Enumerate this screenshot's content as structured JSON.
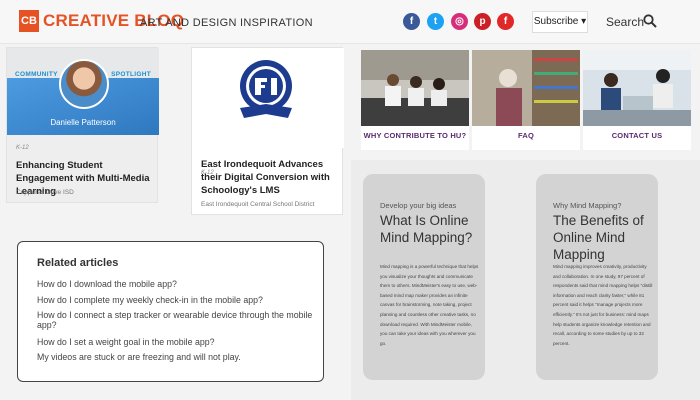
{
  "header": {
    "logo_mark": "CB",
    "logo_name": "CREATIVE BLOQ",
    "tagline": "ART AND DESIGN INSPIRATION",
    "social": [
      {
        "name": "facebook-icon",
        "glyph": "f",
        "color": "#3b5998"
      },
      {
        "name": "twitter-icon",
        "glyph": "t",
        "color": "#1da1f2"
      },
      {
        "name": "instagram-icon",
        "glyph": "◎",
        "color": "#d62e7b"
      },
      {
        "name": "pinterest-icon",
        "glyph": "p",
        "color": "#cb2027"
      },
      {
        "name": "flipboard-icon",
        "glyph": "f",
        "color": "#e12828"
      }
    ],
    "subscribe_label": "Subscribe ▾",
    "search_label": "Search"
  },
  "cards": [
    {
      "chip_left": "COMMUNITY",
      "chip_right": "SPOTLIGHT",
      "person": "Danielle Patterson",
      "tag": "K-12",
      "title": "Enhancing Student Engagement with Multi-Media Learning",
      "source": "Copperas Cove ISD"
    },
    {
      "tag": "K-12",
      "title": "East Irondequoit Advances their Digital Conversion with Schoology's LMS",
      "source": "East Irondequoit Central School District"
    }
  ],
  "tiles": [
    {
      "label": "WHY CONTRIBUTE TO HU?"
    },
    {
      "label": "FAQ"
    },
    {
      "label": "CONTACT US"
    }
  ],
  "mindmap": [
    {
      "kicker": "Develop your big ideas",
      "title": "What Is Online Mind Mapping?",
      "body": "Mind mapping is a powerful technique that helps you visualize your thoughts and communicate them to others. MindMeister's easy to use, web-based mind map maker provides an infinite canvas for brainstorming, note taking, project planning and countless other creative tasks, no download required. With MindMeister mobile, you can take your ideas with you wherever you go."
    },
    {
      "kicker": "Why Mind Mapping?",
      "title": "The Benefits of Online Mind Mapping",
      "body": "Mind mapping improves creativity, productivity and collaboration. In one study, 97 percent of respondents said that mind mapping helps \"distill information and reach clarity faster,\" while 81 percent said it helps \"manage projects more efficiently.\" It's not just for business: mind maps help students organize knowledge retention and recall, according to some studies by up to 32 percent."
    }
  ],
  "related": {
    "heading": "Related articles",
    "items": [
      "How do I download the mobile app?",
      "How do I complete my weekly check-in in the mobile app?",
      "How do I connect a step tracker or wearable device through the mobile app?",
      "How do I set a weight goal in the mobile app?",
      "My videos are stuck or are freezing and will not play."
    ]
  },
  "colors": {
    "brand": "#e55324",
    "tile_label": "#5a2a6e",
    "card_blue": "#3a88cf"
  }
}
